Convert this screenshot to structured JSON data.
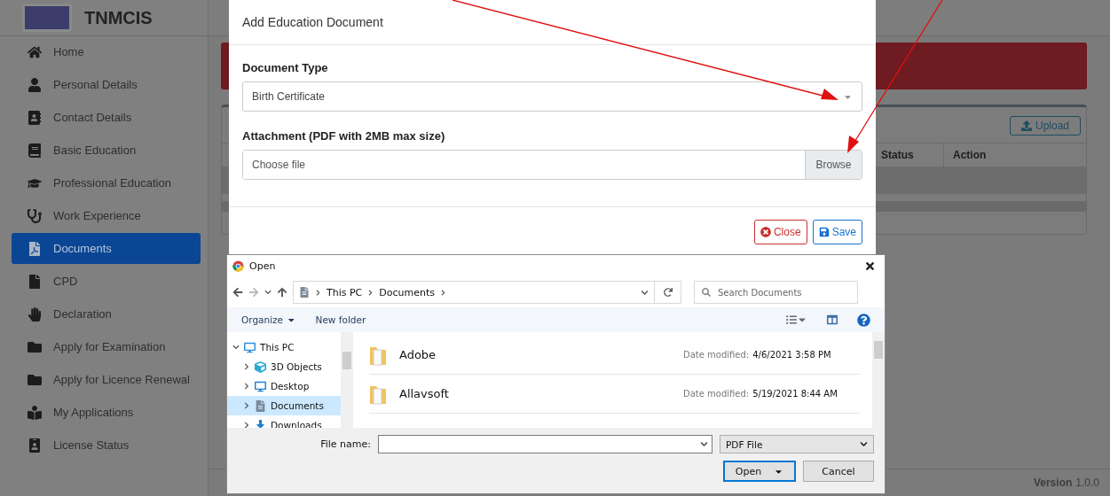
{
  "app": {
    "name": "TNMCIS"
  },
  "sidebar": {
    "items": [
      {
        "label": "Home",
        "selected": false
      },
      {
        "label": "Personal Details",
        "selected": false
      },
      {
        "label": "Contact Details",
        "selected": false
      },
      {
        "label": "Basic Education",
        "selected": false
      },
      {
        "label": "Professional Education",
        "selected": false
      },
      {
        "label": "Work Experience",
        "selected": false
      },
      {
        "label": "Documents",
        "selected": true
      },
      {
        "label": "CPD",
        "selected": false
      },
      {
        "label": "Declaration",
        "selected": false
      },
      {
        "label": "Apply for Examination",
        "selected": false
      },
      {
        "label": "Apply for Licence Renewal",
        "selected": false
      },
      {
        "label": "My Applications",
        "selected": false
      },
      {
        "label": "License Status",
        "selected": false
      }
    ]
  },
  "page": {
    "upload_button": "Upload",
    "table": {
      "columns": [
        "Status",
        "Action"
      ]
    }
  },
  "footer": {
    "version_label": "Version",
    "version": "1.0.0"
  },
  "modal": {
    "title": "Add Education Document",
    "fields": [
      {
        "kind": "select",
        "label": "Document Type",
        "value": "Birth Certificate"
      },
      {
        "kind": "file",
        "label": "Attachment (PDF with 2MB max size)",
        "placeholder": "Choose file",
        "button": "Browse"
      }
    ],
    "buttons": [
      {
        "kind": "close",
        "label": "Close"
      },
      {
        "kind": "save",
        "label": "Save"
      }
    ]
  },
  "file_dialog": {
    "title": "Open",
    "path": [
      "This PC",
      "Documents"
    ],
    "search_placeholder": "Search Documents",
    "toolbar": [
      "Organize",
      "New folder"
    ],
    "tree": [
      {
        "label": "This PC",
        "expanded": true,
        "selected": false,
        "children": [
          {
            "label": "3D Objects",
            "expanded": false,
            "selected": false
          },
          {
            "label": "Desktop",
            "expanded": false,
            "selected": false
          },
          {
            "label": "Documents",
            "expanded": false,
            "selected": true
          },
          {
            "label": "Downloads",
            "expanded": false,
            "selected": false
          }
        ]
      }
    ],
    "files": [
      {
        "name": "Adobe",
        "date_label": "Date modified:",
        "date": "4/6/2021 3:58 PM"
      },
      {
        "name": "Allavsoft",
        "date_label": "Date modified:",
        "date": "5/19/2021 8:44 AM"
      }
    ],
    "file_name_label": "File name:",
    "file_type": "PDF File",
    "buttons": [
      {
        "kind": "default",
        "label": "Open"
      },
      {
        "kind": "normal",
        "label": "Cancel"
      }
    ]
  }
}
